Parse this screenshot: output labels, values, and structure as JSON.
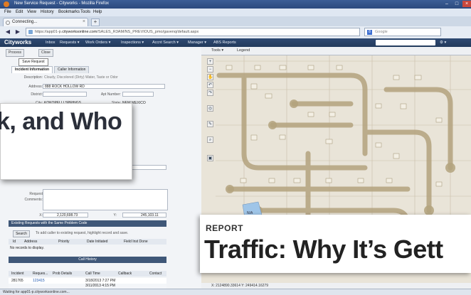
{
  "window": {
    "title": "New Service Request - Cityworks - Mozilla Firefox",
    "controls": {
      "minimize": "–",
      "maximize": "□",
      "close": "×"
    }
  },
  "menu": [
    "File",
    "Edit",
    "View",
    "History",
    "Bookmarks",
    "Tools",
    "Help"
  ],
  "tabs": [
    {
      "label": "Connecting...",
      "close": "×"
    }
  ],
  "newtab": "+",
  "nav": {
    "back": "◀",
    "forward": "▶",
    "url_prefix": "https://app01-p.",
    "url_domain": "cityworksonline.com",
    "url_rest": "/SALES_R3AM/NS_PREVIOUS_pmo/gavenq/default.aspx",
    "search_placeholder": "Google",
    "search_engine_icon": "8"
  },
  "app": {
    "logo": "Cityworks",
    "menu": [
      "Inbox",
      "Requests ▾",
      "Work Orders ▾",
      "Inspections ▾",
      "Accnt Search ▾",
      "Manager ▾",
      "ABS Reports"
    ],
    "settings": "⚙ ▾"
  },
  "form": {
    "toolbar": {
      "process": "Process",
      "close": "Close"
    },
    "tooltip": "Save Request",
    "tabs": {
      "incident": "Incident Information",
      "caller": "Caller Information"
    },
    "description_label": "Description:",
    "description_value": "Cloudy, Discolored (Dirty) Water, Taste or Odor",
    "address_label": "Address:",
    "address_value": "888 ROCK HOLLOW RD",
    "district_label": "District:",
    "apt_label": "Apt Number:",
    "city_label": "City:",
    "city_value": "KOKOPELLI SPRINGS",
    "state_label": "State:",
    "state_value": "NEW MEXICO",
    "request_label": "Request",
    "comments_label": "Comments:",
    "x_label": "X:",
    "x_value": "2,120,698.73",
    "y_label": "Y:",
    "y_value": "245,103.11",
    "existing_header": "Existing Requests with the Same Problem Code",
    "search_btn": "Search",
    "existing_hint": "To add caller to existing request, highlight record and save.",
    "existing_cols": [
      "Id",
      "Address",
      "Priority",
      "Date Initiated",
      "Field Inst Done"
    ],
    "no_records": "No records to display.",
    "call_history_header": "Call History",
    "call_cols": [
      "Incident",
      "Reques...",
      "Prob Details",
      "Call Time",
      "Callback",
      "Contact"
    ],
    "call_rows": [
      {
        "incident": "281765",
        "request": "123415",
        "details": "",
        "time": "3/18/2013 7:27 PM"
      },
      {
        "incident": "",
        "request": "",
        "details": "",
        "time": "3/11/2013 4:15 PM"
      }
    ]
  },
  "overlay": {
    "text": "k, and Who"
  },
  "map": {
    "toolbar": {
      "tools": "Tools ▾",
      "legend": "Legend"
    },
    "tools": [
      "+",
      "−",
      "✋",
      "↶",
      "↷",
      "◎",
      "✎",
      "⌕",
      "▣"
    ],
    "coords": "X: 2124890.33614  Y: 249414.16279",
    "label": "N/A"
  },
  "report": {
    "kicker": "REPORT",
    "headline": "Traffic: Why It’s Gett"
  },
  "status": "Waiting for app01-p.cityworksonline.com..."
}
